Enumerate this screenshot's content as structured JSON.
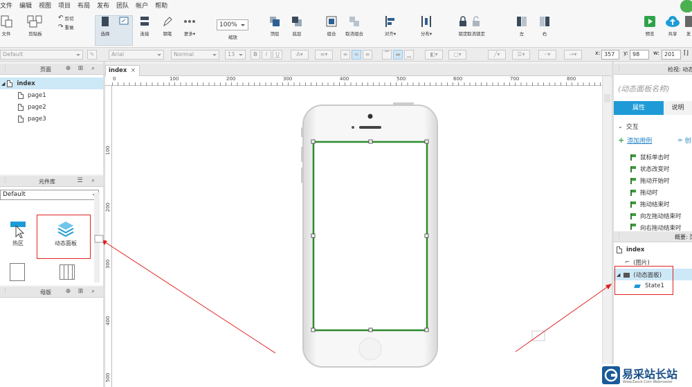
{
  "menu": [
    "文件",
    "编辑",
    "视图",
    "项目",
    "布局",
    "发布",
    "团队",
    "帐户",
    "帮助"
  ],
  "toolbar": {
    "file": "文件",
    "clipboard": "剪贴板",
    "cut_label": "剪切",
    "redo_label": "重做",
    "select": "选择",
    "connect": "连接",
    "pen": "钢笔",
    "more": "更多▾",
    "zoom_value": "100%",
    "zoom_label": "缩放",
    "top": "顶层",
    "bottom": "底层",
    "group": "组合",
    "ungroup": "取消组合",
    "align": "对齐▾",
    "distribute": "分布▾",
    "lock": "锁定",
    "unlock": "取消锁定",
    "left": "左",
    "right": "右",
    "preview": "预览",
    "share": "共享",
    "publish": "发"
  },
  "format": {
    "style": "Default",
    "font": "Arial",
    "weight": "Normal",
    "size": "13",
    "x_label": "x:",
    "x_value": "357",
    "y_label": "y:",
    "y_value": "98",
    "w_label": "w:",
    "w_value": "201"
  },
  "pages_panel": {
    "title": "页面",
    "items": [
      "index",
      "page1",
      "page2",
      "page3"
    ]
  },
  "widgets_panel": {
    "title": "元件库",
    "library": "Default",
    "items": [
      "热区",
      "动态面板"
    ]
  },
  "masters_panel": {
    "title": "母版"
  },
  "canvas": {
    "tab": "index",
    "ruler_top": [
      "0",
      "100",
      "200",
      "300",
      "400",
      "500",
      "600",
      "700",
      "800"
    ],
    "ruler_left": [
      "100",
      "200",
      "300",
      "400",
      "500"
    ]
  },
  "inspector": {
    "header": "检视: 动态",
    "name_placeholder": "(动态面板名称)",
    "tab_props": "属性",
    "tab_notes": "说明",
    "section": "交互",
    "add_case": "添加用例",
    "more_link": "创",
    "events": [
      "鼠标单击时",
      "状态改变时",
      "拖动开始时",
      "拖动时",
      "拖动结束时",
      "向左拖动结束时",
      "向右拖动结束时"
    ]
  },
  "outline": {
    "header": "概要: 页",
    "root": "index",
    "items": [
      "(图片)",
      "(动态面板)",
      "State1"
    ]
  },
  "watermark": {
    "title": "易采站长站",
    "subtitle": "Www.Easck.Com Webmaster"
  },
  "colors": {
    "accent": "#1e9bd7",
    "selection": "#cde8f6",
    "annotation": "#e02020",
    "panel_border": "#2e8b2e"
  }
}
